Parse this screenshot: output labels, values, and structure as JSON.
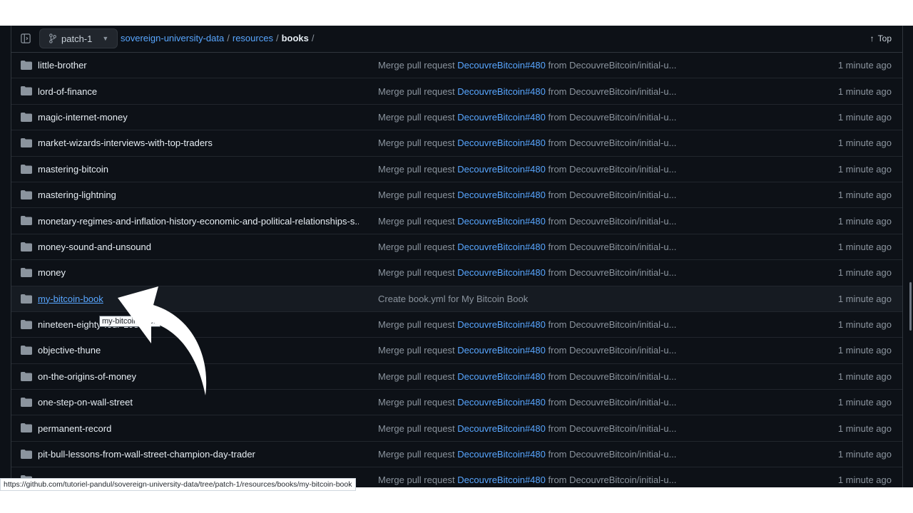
{
  "header": {
    "branch": "patch-1",
    "breadcrumb": {
      "repo": "sovereign-university-data",
      "sep1": "/",
      "folder": "resources",
      "sep2": "/",
      "current": "books",
      "sep3": "/"
    },
    "top_label": "Top"
  },
  "rows": [
    {
      "name": "little-brother",
      "msg_prefix": "Merge pull request",
      "pr": "DecouvreBitcoin#480",
      "msg_suffix": "from DecouvreBitcoin/initial-u...",
      "time": "1 minute ago"
    },
    {
      "name": "lord-of-finance",
      "msg_prefix": "Merge pull request",
      "pr": "DecouvreBitcoin#480",
      "msg_suffix": "from DecouvreBitcoin/initial-u...",
      "time": "1 minute ago"
    },
    {
      "name": "magic-internet-money",
      "msg_prefix": "Merge pull request",
      "pr": "DecouvreBitcoin#480",
      "msg_suffix": "from DecouvreBitcoin/initial-u...",
      "time": "1 minute ago"
    },
    {
      "name": "market-wizards-interviews-with-top-traders",
      "msg_prefix": "Merge pull request",
      "pr": "DecouvreBitcoin#480",
      "msg_suffix": "from DecouvreBitcoin/initial-u...",
      "time": "1 minute ago"
    },
    {
      "name": "mastering-bitcoin",
      "msg_prefix": "Merge pull request",
      "pr": "DecouvreBitcoin#480",
      "msg_suffix": "from DecouvreBitcoin/initial-u...",
      "time": "1 minute ago"
    },
    {
      "name": "mastering-lightning",
      "msg_prefix": "Merge pull request",
      "pr": "DecouvreBitcoin#480",
      "msg_suffix": "from DecouvreBitcoin/initial-u...",
      "time": "1 minute ago"
    },
    {
      "name": "monetary-regimes-and-inflation-history-economic-and-political-relationships-s...",
      "msg_prefix": "Merge pull request",
      "pr": "DecouvreBitcoin#480",
      "msg_suffix": "from DecouvreBitcoin/initial-u...",
      "time": "1 minute ago"
    },
    {
      "name": "money-sound-and-unsound",
      "msg_prefix": "Merge pull request",
      "pr": "DecouvreBitcoin#480",
      "msg_suffix": "from DecouvreBitcoin/initial-u...",
      "time": "1 minute ago"
    },
    {
      "name": "money",
      "msg_prefix": "Merge pull request",
      "pr": "DecouvreBitcoin#480",
      "msg_suffix": "from DecouvreBitcoin/initial-u...",
      "time": "1 minute ago"
    },
    {
      "name": "my-bitcoin-book",
      "msg_prefix": "Create book.yml for My Bitcoin Book",
      "pr": "",
      "msg_suffix": "",
      "time": "1 minute ago",
      "hover": true
    },
    {
      "name": "nineteen-eighty-four-1984",
      "msg_prefix": "Merge pull request",
      "pr": "DecouvreBitcoin#480",
      "msg_suffix": "from DecouvreBitcoin/initial-u...",
      "time": "1 minute ago"
    },
    {
      "name": "objective-thune",
      "msg_prefix": "Merge pull request",
      "pr": "DecouvreBitcoin#480",
      "msg_suffix": "from DecouvreBitcoin/initial-u...",
      "time": "1 minute ago"
    },
    {
      "name": "on-the-origins-of-money",
      "msg_prefix": "Merge pull request",
      "pr": "DecouvreBitcoin#480",
      "msg_suffix": "from DecouvreBitcoin/initial-u...",
      "time": "1 minute ago"
    },
    {
      "name": "one-step-on-wall-street",
      "msg_prefix": "Merge pull request",
      "pr": "DecouvreBitcoin#480",
      "msg_suffix": "from DecouvreBitcoin/initial-u...",
      "time": "1 minute ago"
    },
    {
      "name": "permanent-record",
      "msg_prefix": "Merge pull request",
      "pr": "DecouvreBitcoin#480",
      "msg_suffix": "from DecouvreBitcoin/initial-u...",
      "time": "1 minute ago"
    },
    {
      "name": "pit-bull-lessons-from-wall-street-champion-day-trader",
      "msg_prefix": "Merge pull request",
      "pr": "DecouvreBitcoin#480",
      "msg_suffix": "from DecouvreBitcoin/initial-u...",
      "time": "1 minute ago"
    },
    {
      "name": "",
      "msg_prefix": "Merge pull request",
      "pr": "DecouvreBitcoin#480",
      "msg_suffix": "from DecouvreBitcoin/initial-u...",
      "time": "1 minute ago"
    }
  ],
  "tooltip": "my-bitcoin-book",
  "status_url": "https://github.com/tutoriel-pandul/sovereign-university-data/tree/patch-1/resources/books/my-bitcoin-book",
  "colors": {
    "link": "#58a6ff",
    "background": "#0d1117",
    "arrow": "#ffffff"
  }
}
